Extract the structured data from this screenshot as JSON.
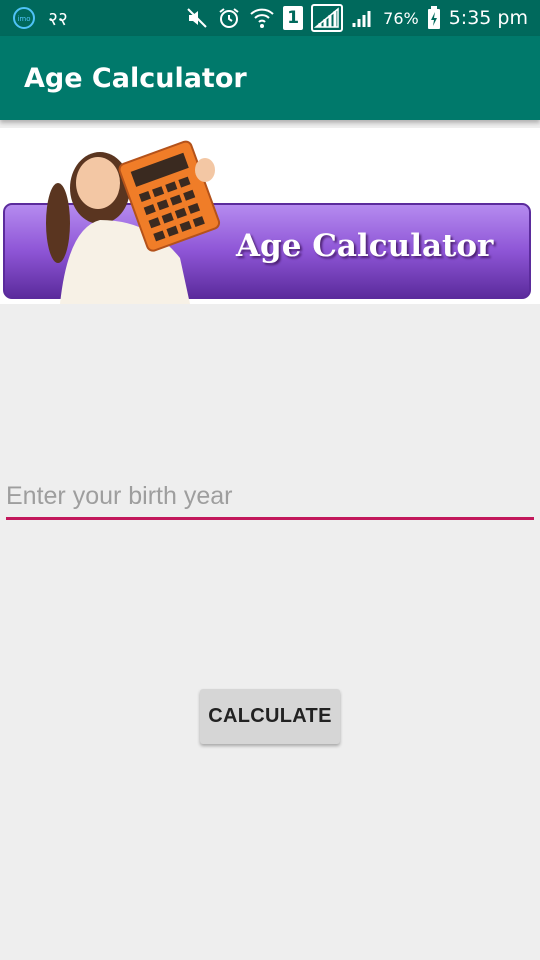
{
  "status_bar": {
    "carrier_text": "२२",
    "sim_number": "1",
    "battery_percent": "76%",
    "time": "5:35 pm",
    "icons": [
      "imo-icon",
      "mute-icon",
      "alarm-icon",
      "wifi-icon",
      "signal-icon",
      "battery-charging-icon"
    ]
  },
  "app_bar": {
    "title": "Age Calculator",
    "color": "#00796b"
  },
  "banner": {
    "text": "Age Calculator"
  },
  "form": {
    "birth_year_placeholder": "Enter your birth year",
    "birth_year_value": "",
    "calculate_label": "CALCULATE"
  },
  "colors": {
    "primary": "#00796b",
    "primary_dark": "#00695c",
    "accent": "#c2185b",
    "background": "#eeeeee"
  }
}
